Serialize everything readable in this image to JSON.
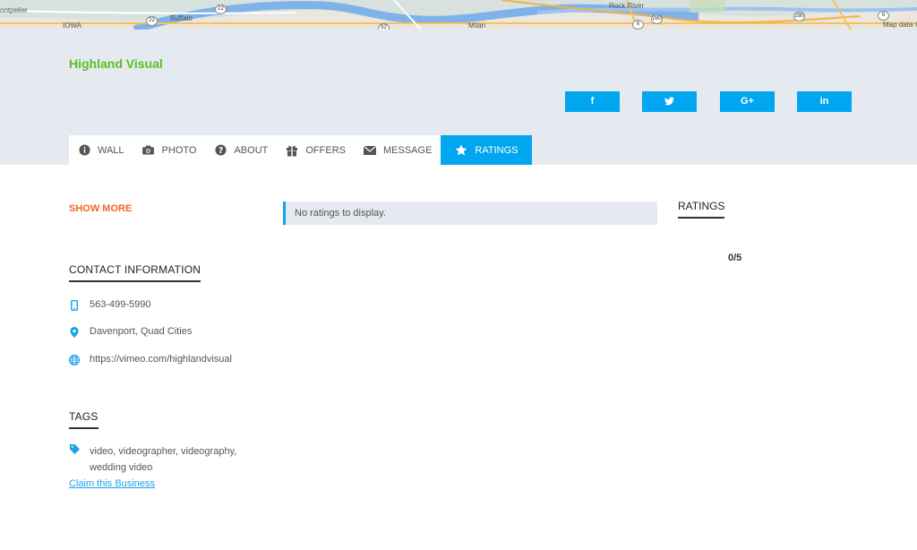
{
  "map": {
    "labels": [
      "ontpelier",
      "Buffalo",
      "IOWA",
      "Milan",
      "Rock River",
      "Map data ©"
    ],
    "shields": [
      "22",
      "22",
      "6",
      "280",
      "280",
      "6",
      "92",
      "93"
    ]
  },
  "business": {
    "name": "Highland Visual"
  },
  "social": [
    {
      "label": "f",
      "icon": "facebook-icon"
    },
    {
      "label": "🐦",
      "icon": "twitter-icon"
    },
    {
      "label": "G+",
      "icon": "google-plus-icon"
    },
    {
      "label": "in",
      "icon": "linkedin-icon"
    }
  ],
  "tabs": [
    {
      "label": "WALL",
      "icon": "info-icon"
    },
    {
      "label": "PHOTO",
      "icon": "camera-icon"
    },
    {
      "label": "ABOUT",
      "icon": "question-icon"
    },
    {
      "label": "OFFERS",
      "icon": "gift-icon"
    },
    {
      "label": "MESSAGE",
      "icon": "envelope-icon"
    },
    {
      "label": "RATINGS",
      "icon": "star-icon",
      "active": true
    }
  ],
  "left": {
    "show_more": "SHOW MORE",
    "contact_title": "CONTACT INFORMATION",
    "phone": "563-499-5990",
    "location": "Davenport, Quad Cities",
    "website": "https://vimeo.com/highlandvisual",
    "tags_title": "TAGS",
    "tags": "video, videographer, videography, wedding video",
    "claim": "Claim this Business"
  },
  "center": {
    "notice": "No ratings to display."
  },
  "right": {
    "ratings_title": "RATINGS",
    "score": "0/5"
  },
  "colors": {
    "accent": "#00a6f0",
    "brand_green": "#5bbf21",
    "orange": "#f26722",
    "header_bg": "#e4eaf0"
  }
}
